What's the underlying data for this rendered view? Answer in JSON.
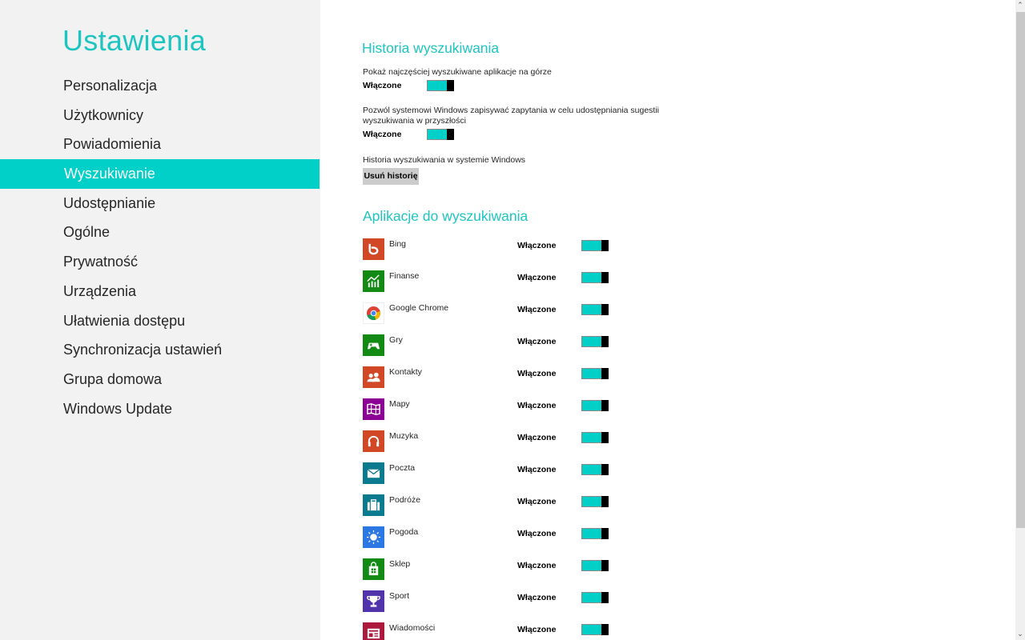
{
  "sidebar": {
    "title": "Ustawienia",
    "items": [
      {
        "label": "Personalizacja",
        "active": false
      },
      {
        "label": "Użytkownicy",
        "active": false
      },
      {
        "label": "Powiadomienia",
        "active": false
      },
      {
        "label": "Wyszukiwanie",
        "active": true
      },
      {
        "label": "Udostępnianie",
        "active": false
      },
      {
        "label": "Ogólne",
        "active": false
      },
      {
        "label": "Prywatność",
        "active": false
      },
      {
        "label": "Urządzenia",
        "active": false
      },
      {
        "label": "Ułatwienia dostępu",
        "active": false
      },
      {
        "label": "Synchronizacja ustawień",
        "active": false
      },
      {
        "label": "Grupa domowa",
        "active": false
      },
      {
        "label": "Windows Update",
        "active": false
      }
    ]
  },
  "history": {
    "title": "Historia wyszukiwania",
    "setting1": {
      "label": "Pokaż najczęściej wyszukiwane aplikacje na górze",
      "state": "Włączone",
      "on": true
    },
    "setting2": {
      "label_line1": "Pozwól systemowi Windows zapisywać zapytania w celu udostępniania sugestii",
      "label_line2": "wyszukiwania w przyszłości",
      "state": "Włączone",
      "on": true
    },
    "clear": {
      "label": "Historia wyszukiwania w systemie Windows",
      "button": "Usuń historię"
    }
  },
  "apps": {
    "title": "Aplikacje do wyszukiwania",
    "items": [
      {
        "name": "Bing",
        "state": "Włączone",
        "on": true,
        "icon": "bing-icon",
        "color": "#d24726"
      },
      {
        "name": "Finanse",
        "state": "Włączone",
        "on": true,
        "icon": "finance-chart-icon",
        "color": "#128a13"
      },
      {
        "name": "Google Chrome",
        "state": "Włączone",
        "on": true,
        "icon": "chrome-icon",
        "color": "#ffffff"
      },
      {
        "name": "Gry",
        "state": "Włączone",
        "on": true,
        "icon": "gamepad-icon",
        "color": "#128a13"
      },
      {
        "name": "Kontakty",
        "state": "Włączone",
        "on": true,
        "icon": "people-icon",
        "color": "#d24726"
      },
      {
        "name": "Mapy",
        "state": "Włączone",
        "on": true,
        "icon": "map-icon",
        "color": "#8c0095"
      },
      {
        "name": "Muzyka",
        "state": "Włączone",
        "on": true,
        "icon": "headphones-icon",
        "color": "#d24726"
      },
      {
        "name": "Poczta",
        "state": "Włączone",
        "on": true,
        "icon": "mail-icon",
        "color": "#0a7a8f"
      },
      {
        "name": "Podróże",
        "state": "Włączone",
        "on": true,
        "icon": "suitcase-icon",
        "color": "#0a7a8f"
      },
      {
        "name": "Pogoda",
        "state": "Włączone",
        "on": true,
        "icon": "sun-icon",
        "color": "#2b78e4"
      },
      {
        "name": "Sklep",
        "state": "Włączone",
        "on": true,
        "icon": "store-bag-icon",
        "color": "#128a13"
      },
      {
        "name": "Sport",
        "state": "Włączone",
        "on": true,
        "icon": "trophy-icon",
        "color": "#5133ab"
      },
      {
        "name": "Wiadomości",
        "state": "Włączone",
        "on": true,
        "icon": "newspaper-icon",
        "color": "#ac193d"
      }
    ]
  },
  "colors": {
    "accent": "#00d0c8",
    "accent_text": "#1ec5c0",
    "sidebar_bg": "#f2f2f2"
  }
}
